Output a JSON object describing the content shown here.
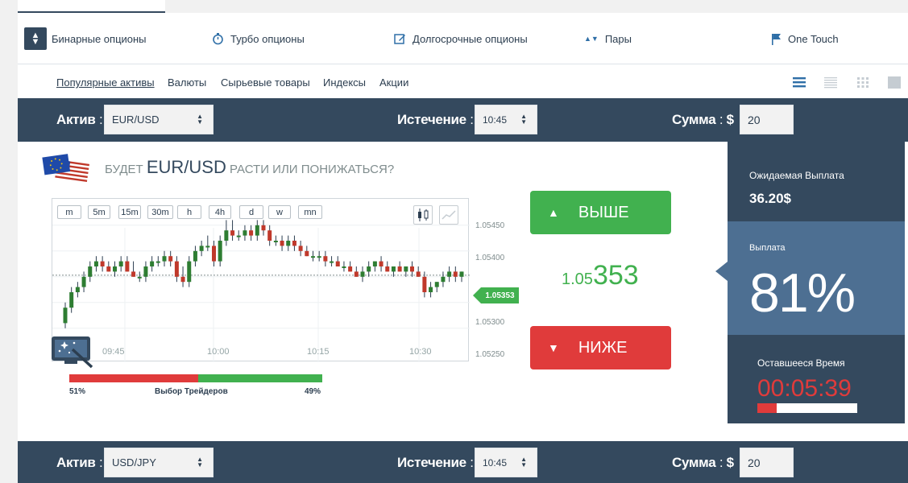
{
  "option_types": [
    {
      "label": "Бинарные опционы",
      "icon": "sort-icon",
      "active": true
    },
    {
      "label": "Турбо опционы",
      "icon": "stopwatch-icon",
      "active": false
    },
    {
      "label": "Долгосрочные опционы",
      "icon": "edit-icon",
      "active": false
    },
    {
      "label": "Пары",
      "icon": "up-down-arrows-icon",
      "active": false
    },
    {
      "label": "One Touch",
      "icon": "flag-icon",
      "active": false
    }
  ],
  "categories": [
    {
      "label": "Популярные активы",
      "active": true
    },
    {
      "label": "Валюты"
    },
    {
      "label": "Сырьевые товары"
    },
    {
      "label": "Индексы"
    },
    {
      "label": "Акции"
    }
  ],
  "trade_rows": [
    {
      "asset_label": "Актив",
      "asset": "EUR/USD",
      "expiry_label": "Истечение",
      "expiry": "10:45",
      "amount_label": "Сумма",
      "currency": "$",
      "amount": "20"
    },
    {
      "asset_label": "Актив",
      "asset": "USD/JPY",
      "expiry_label": "Истечение",
      "expiry": "10:45",
      "amount_label": "Сумма",
      "currency": "$",
      "amount": "20"
    }
  ],
  "question": {
    "prefix": "БУДЕТ",
    "pair": "EUR/USD",
    "suffix": "РАСТИ ИЛИ ПОНИЖАТЬСЯ?"
  },
  "timeframes": [
    "m",
    "5m",
    "15m",
    "30m",
    "h",
    "4h",
    "d",
    "w",
    "mn"
  ],
  "current_price": "1.05353",
  "price_display": {
    "small": "1.05",
    "large": "353"
  },
  "buttons": {
    "up": "ВЫШЕ",
    "down": "НИЖЕ"
  },
  "sentiment": {
    "down_pct": 51,
    "up_pct": 49,
    "down_label": "51%",
    "up_label": "49%",
    "title": "Выбор Трейдеров"
  },
  "expected_payout": {
    "label": "Ожидаемая Выплата",
    "value": "36.20$"
  },
  "payout": {
    "label": "Выплата",
    "value": "81%"
  },
  "time_left": {
    "label": "Оставшееся Время",
    "value": "00:05:39",
    "fraction_elapsed": 0.19
  },
  "colors": {
    "dark": "#34495e",
    "mid": "#4d6f92",
    "green": "#41b14f",
    "red": "#e03b3b"
  },
  "chart_data": {
    "type": "candlestick",
    "y_ticks": [
      "1.05450",
      "1.05400",
      "1.05300",
      "1.05250"
    ],
    "x_ticks": [
      "09:45",
      "10:00",
      "10:15",
      "10:30"
    ],
    "ylim": [
      1.0522,
      1.0547
    ],
    "current": 1.05353,
    "candles": [
      [
        1.0526,
        1.053,
        1.0525,
        1.0529
      ],
      [
        1.0529,
        1.0533,
        1.0528,
        1.0532
      ],
      [
        1.0532,
        1.0534,
        1.0531,
        1.0533
      ],
      [
        1.0533,
        1.0536,
        1.0532,
        1.0535
      ],
      [
        1.0535,
        1.0538,
        1.0534,
        1.0537
      ],
      [
        1.0537,
        1.0539,
        1.0536,
        1.0538
      ],
      [
        1.0538,
        1.0539,
        1.0536,
        1.0537
      ],
      [
        1.0537,
        1.0538,
        1.0536,
        1.0536
      ],
      [
        1.0536,
        1.0538,
        1.0535,
        1.0537
      ],
      [
        1.0537,
        1.0539,
        1.0536,
        1.0538
      ],
      [
        1.0538,
        1.0539,
        1.0536,
        1.0536
      ],
      [
        1.0536,
        1.0538,
        1.0535,
        1.0535
      ],
      [
        1.0535,
        1.0536,
        1.0534,
        1.0535
      ],
      [
        1.0535,
        1.0538,
        1.0534,
        1.0537
      ],
      [
        1.0537,
        1.0539,
        1.0536,
        1.0538
      ],
      [
        1.0538,
        1.0539,
        1.0537,
        1.0538
      ],
      [
        1.0538,
        1.054,
        1.0537,
        1.0539
      ],
      [
        1.0539,
        1.054,
        1.0537,
        1.0538
      ],
      [
        1.0538,
        1.0539,
        1.0534,
        1.0535
      ],
      [
        1.0535,
        1.0537,
        1.0533,
        1.0534
      ],
      [
        1.0534,
        1.0539,
        1.0533,
        1.0538
      ],
      [
        1.0538,
        1.0541,
        1.0537,
        1.054
      ],
      [
        1.054,
        1.0542,
        1.0539,
        1.0541
      ],
      [
        1.0541,
        1.0543,
        1.054,
        1.0541
      ],
      [
        1.0541,
        1.0542,
        1.0537,
        1.0538
      ],
      [
        1.0538,
        1.0543,
        1.0537,
        1.0542
      ],
      [
        1.0542,
        1.0546,
        1.0541,
        1.0544
      ],
      [
        1.0544,
        1.0546,
        1.0542,
        1.0543
      ],
      [
        1.0543,
        1.0544,
        1.0542,
        1.0543
      ],
      [
        1.0543,
        1.0545,
        1.0542,
        1.0544
      ],
      [
        1.0544,
        1.0545,
        1.0542,
        1.0543
      ],
      [
        1.0543,
        1.0546,
        1.0542,
        1.0545
      ],
      [
        1.0545,
        1.0546,
        1.0543,
        1.0544
      ],
      [
        1.0544,
        1.0545,
        1.0541,
        1.0542
      ],
      [
        1.0542,
        1.0543,
        1.0541,
        1.0542
      ],
      [
        1.0542,
        1.0543,
        1.054,
        1.0541
      ],
      [
        1.0541,
        1.0543,
        1.054,
        1.0542
      ],
      [
        1.0542,
        1.0543,
        1.054,
        1.0541
      ],
      [
        1.0541,
        1.0542,
        1.0539,
        1.054
      ],
      [
        1.054,
        1.0541,
        1.0539,
        1.0539
      ],
      [
        1.0539,
        1.054,
        1.0538,
        1.0539
      ],
      [
        1.0539,
        1.054,
        1.0538,
        1.0539
      ],
      [
        1.0539,
        1.054,
        1.0537,
        1.0538
      ],
      [
        1.0538,
        1.0539,
        1.0537,
        1.0538
      ],
      [
        1.0538,
        1.0539,
        1.0537,
        1.0537
      ],
      [
        1.0537,
        1.0538,
        1.0536,
        1.0537
      ],
      [
        1.0537,
        1.0538,
        1.0536,
        1.0536
      ],
      [
        1.0536,
        1.0537,
        1.0535,
        1.0535
      ],
      [
        1.0535,
        1.0537,
        1.0534,
        1.0536
      ],
      [
        1.0536,
        1.0538,
        1.0535,
        1.0537
      ],
      [
        1.0537,
        1.0538,
        1.0536,
        1.0538
      ],
      [
        1.0538,
        1.0539,
        1.0536,
        1.0537
      ],
      [
        1.0537,
        1.0538,
        1.0536,
        1.0536
      ],
      [
        1.0536,
        1.0537,
        1.0535,
        1.0537
      ],
      [
        1.0537,
        1.0538,
        1.0536,
        1.0536
      ],
      [
        1.0536,
        1.0537,
        1.0535,
        1.0537
      ],
      [
        1.0537,
        1.0538,
        1.0535,
        1.0536
      ],
      [
        1.0536,
        1.0537,
        1.0535,
        1.0535
      ],
      [
        1.0535,
        1.0536,
        1.0531,
        1.0532
      ],
      [
        1.0532,
        1.0534,
        1.0531,
        1.0533
      ],
      [
        1.0533,
        1.0534,
        1.0532,
        1.0534
      ],
      [
        1.0534,
        1.0536,
        1.0533,
        1.0535
      ],
      [
        1.0535,
        1.0537,
        1.0534,
        1.0536
      ],
      [
        1.0536,
        1.0537,
        1.0534,
        1.0535
      ],
      [
        1.0535,
        1.0536,
        1.0534,
        1.0536
      ]
    ]
  }
}
